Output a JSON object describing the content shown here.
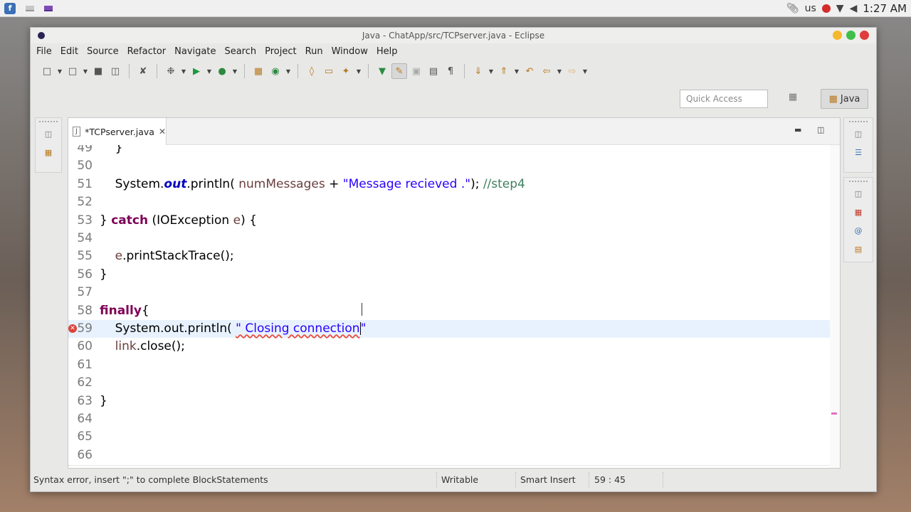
{
  "system_bar": {
    "tray": {
      "keyboard_layout": "us"
    },
    "clock": "1:27 AM"
  },
  "window": {
    "title": "Java - ChatApp/src/TCPserver.java - Eclipse",
    "controls": {
      "minimize_color": "#f5b72c",
      "maximize_color": "#3fbf4a",
      "close_color": "#e03c3c"
    }
  },
  "menu": [
    "File",
    "Edit",
    "Source",
    "Refactor",
    "Navigate",
    "Search",
    "Project",
    "Run",
    "Window",
    "Help"
  ],
  "toolbar": {
    "quick_access_placeholder": "Quick Access",
    "perspective_label": "Java"
  },
  "editor": {
    "tab_label": "*TCPserver.java",
    "current_line": 59,
    "lines": [
      {
        "n": "49",
        "segments": [
          {
            "t": "    }"
          }
        ]
      },
      {
        "n": "50",
        "segments": []
      },
      {
        "n": "51",
        "segments": [
          {
            "t": "    System."
          },
          {
            "t": "out",
            "c": "fld"
          },
          {
            "t": ".println( "
          },
          {
            "t": "numMessages",
            "c": "var"
          },
          {
            "t": " + "
          },
          {
            "t": "\"Message recieved .\"",
            "c": "str"
          },
          {
            "t": "); "
          },
          {
            "t": "//step4",
            "c": "cmt"
          }
        ]
      },
      {
        "n": "52",
        "segments": []
      },
      {
        "n": "53",
        "segments": [
          {
            "t": "} "
          },
          {
            "t": "catch",
            "c": "kw"
          },
          {
            "t": " (IOException "
          },
          {
            "t": "e",
            "c": "var"
          },
          {
            "t": ") {"
          }
        ]
      },
      {
        "n": "54",
        "segments": []
      },
      {
        "n": "55",
        "segments": [
          {
            "t": "    "
          },
          {
            "t": "e",
            "c": "var"
          },
          {
            "t": ".printStackTrace();"
          }
        ]
      },
      {
        "n": "56",
        "segments": [
          {
            "t": "}"
          }
        ]
      },
      {
        "n": "57",
        "segments": []
      },
      {
        "n": "58",
        "segments": [
          {
            "t": "finally",
            "c": "kw"
          },
          {
            "t": "{"
          }
        ]
      },
      {
        "n": "59",
        "error": true,
        "segments": [
          {
            "t": "    System.out.println( "
          },
          {
            "t": "\" Closing connection",
            "c": "str err"
          },
          {
            "t": "|",
            "c": "caret"
          },
          {
            "t": "\"",
            "c": "str"
          }
        ]
      },
      {
        "n": "60",
        "segments": [
          {
            "t": "    "
          },
          {
            "t": "link",
            "c": "var"
          },
          {
            "t": ".close();"
          }
        ]
      },
      {
        "n": "61",
        "segments": []
      },
      {
        "n": "62",
        "segments": []
      },
      {
        "n": "63",
        "segments": [
          {
            "t": "}"
          }
        ]
      },
      {
        "n": "64",
        "segments": []
      },
      {
        "n": "65",
        "segments": []
      },
      {
        "n": "66",
        "segments": []
      }
    ]
  },
  "status_bar": {
    "message": "Syntax error, insert \";\" to complete BlockStatements",
    "writable": "Writable",
    "insert_mode": "Smart Insert",
    "position": "59 : 45"
  }
}
